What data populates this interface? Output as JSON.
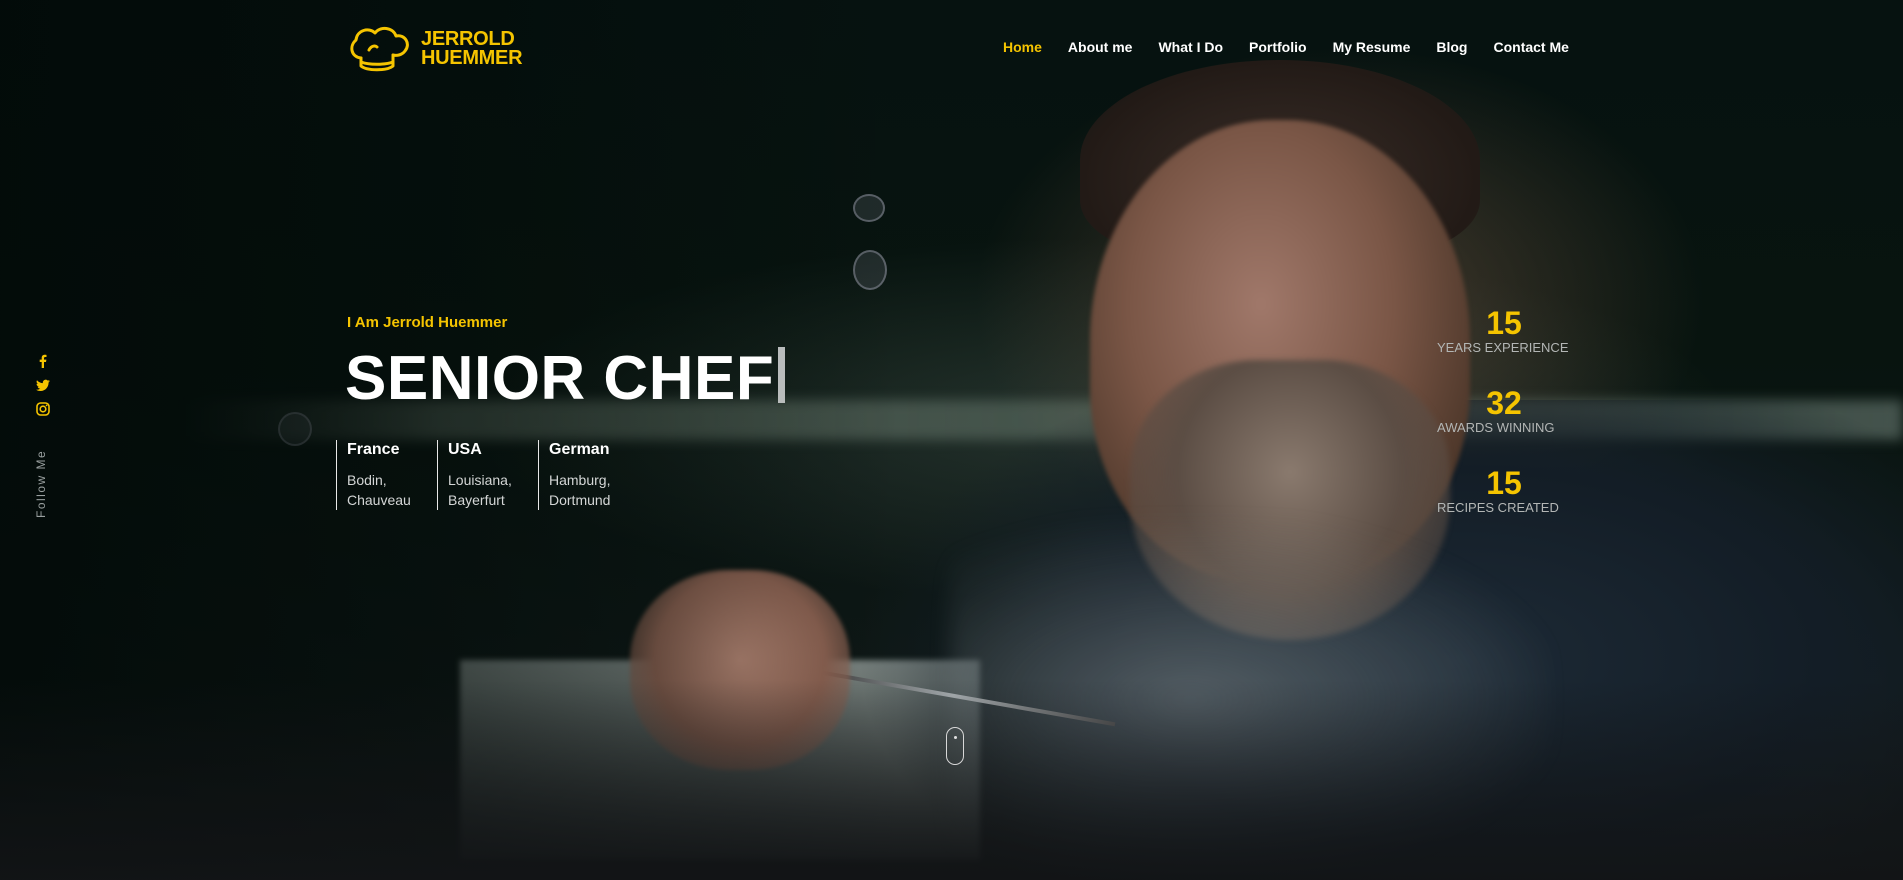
{
  "brand": {
    "line1": "JERROLD",
    "line2": "HUEMMER",
    "logo_icon": "chef-hat-icon",
    "accent_color": "#f5c400"
  },
  "nav": {
    "items": [
      {
        "label": "Home",
        "active": true
      },
      {
        "label": "About me"
      },
      {
        "label": "What I Do"
      },
      {
        "label": "Portfolio"
      },
      {
        "label": "My Resume"
      },
      {
        "label": "Blog"
      },
      {
        "label": "Contact Me"
      }
    ]
  },
  "social": {
    "icons": [
      "facebook-icon",
      "twitter-icon",
      "instagram-icon"
    ],
    "follow_label": "Follow Me"
  },
  "hero": {
    "intro": "I Am Jerrold Huemmer",
    "title": "SENIOR CHEF",
    "locations": [
      {
        "country": "France",
        "cities": "Bodin, Chauveau"
      },
      {
        "country": "USA",
        "cities": "Louisiana, Bayerfurt"
      },
      {
        "country": "German",
        "cities": "Hamburg, Dortmund"
      }
    ]
  },
  "stats": [
    {
      "value": "15",
      "label": "YEARS EXPERIENCE"
    },
    {
      "value": "32",
      "label": "AWARDS WINNING"
    },
    {
      "value": "15",
      "label": "RECIPES CREATED"
    }
  ],
  "scroll_indicator": "mouse-scroll-icon"
}
